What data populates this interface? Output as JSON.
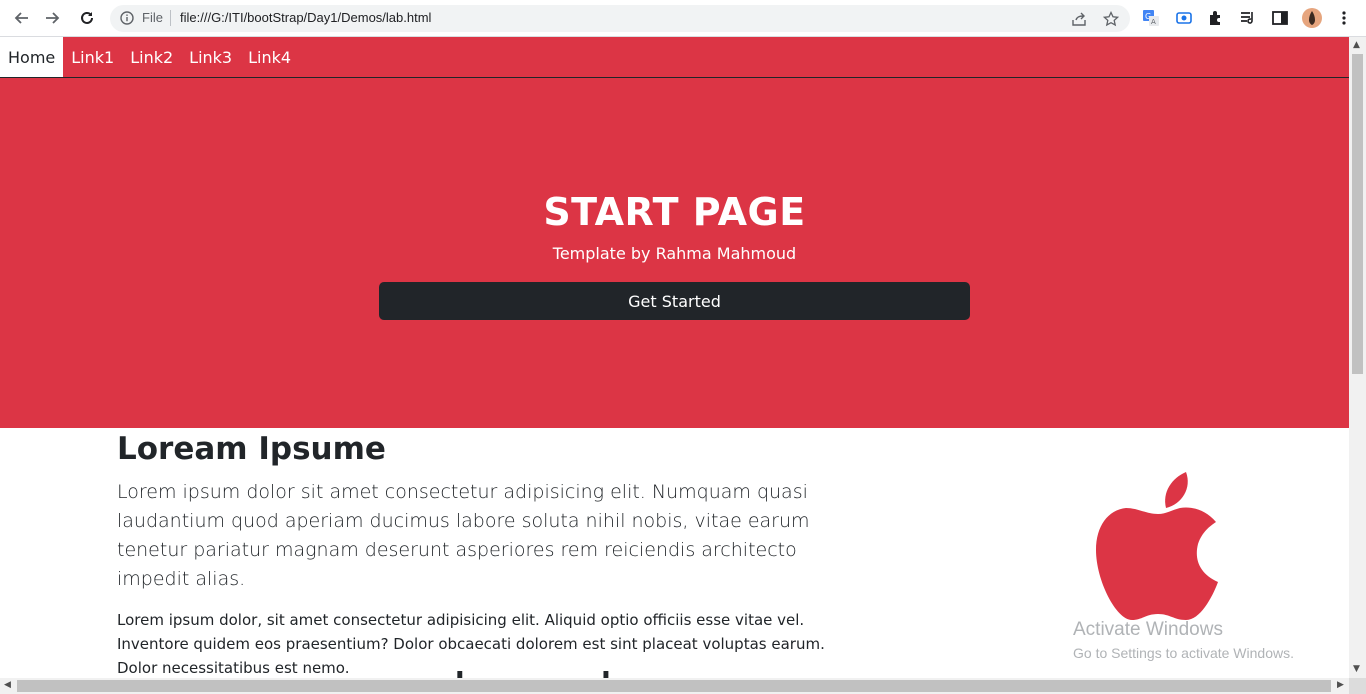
{
  "browser": {
    "scheme_label": "File",
    "url": "file:///G:/ITI/bootStrap/Day1/Demos/lab.html",
    "icons": [
      "back-icon",
      "forward-icon",
      "reload-icon",
      "info-icon",
      "share-icon",
      "star-icon",
      "translate-icon",
      "screencast-icon",
      "extensions-icon",
      "reading-list-icon",
      "side-panel-icon",
      "avatar",
      "menu-icon"
    ]
  },
  "navbar": {
    "links": [
      {
        "label": "Home",
        "active": true
      },
      {
        "label": "Link1"
      },
      {
        "label": "Link2"
      },
      {
        "label": "Link3"
      },
      {
        "label": "Link4"
      }
    ]
  },
  "hero": {
    "title": "START PAGE",
    "subtitle": "Template by Rahma Mahmoud",
    "button_label": "Get Started"
  },
  "content": {
    "heading": "Loream Ipsume",
    "lead": "Lorem ipsum dolor sit amet consectetur adipisicing elit. Numquam quasi laudantium quod aperiam ducimus labore soluta nihil nobis, vitae earum tenetur pariatur magnam deserunt asperiores rem reiciendis architecto impedit alias.",
    "paragraph": "Lorem ipsum dolor, sit amet consectetur adipisicing elit. Aliquid optio officiis esse vitae vel. Inventore quidem eos praesentium? Dolor obcaecati dolorem est sint placeat voluptas earum. Dolor necessitatibus est nemo.",
    "image_icon": "apple-logo-icon"
  },
  "watermark": {
    "title": "Activate Windows",
    "subtitle": "Go to Settings to activate Windows."
  },
  "colors": {
    "brand": "#dc3545",
    "dark": "#212529"
  }
}
